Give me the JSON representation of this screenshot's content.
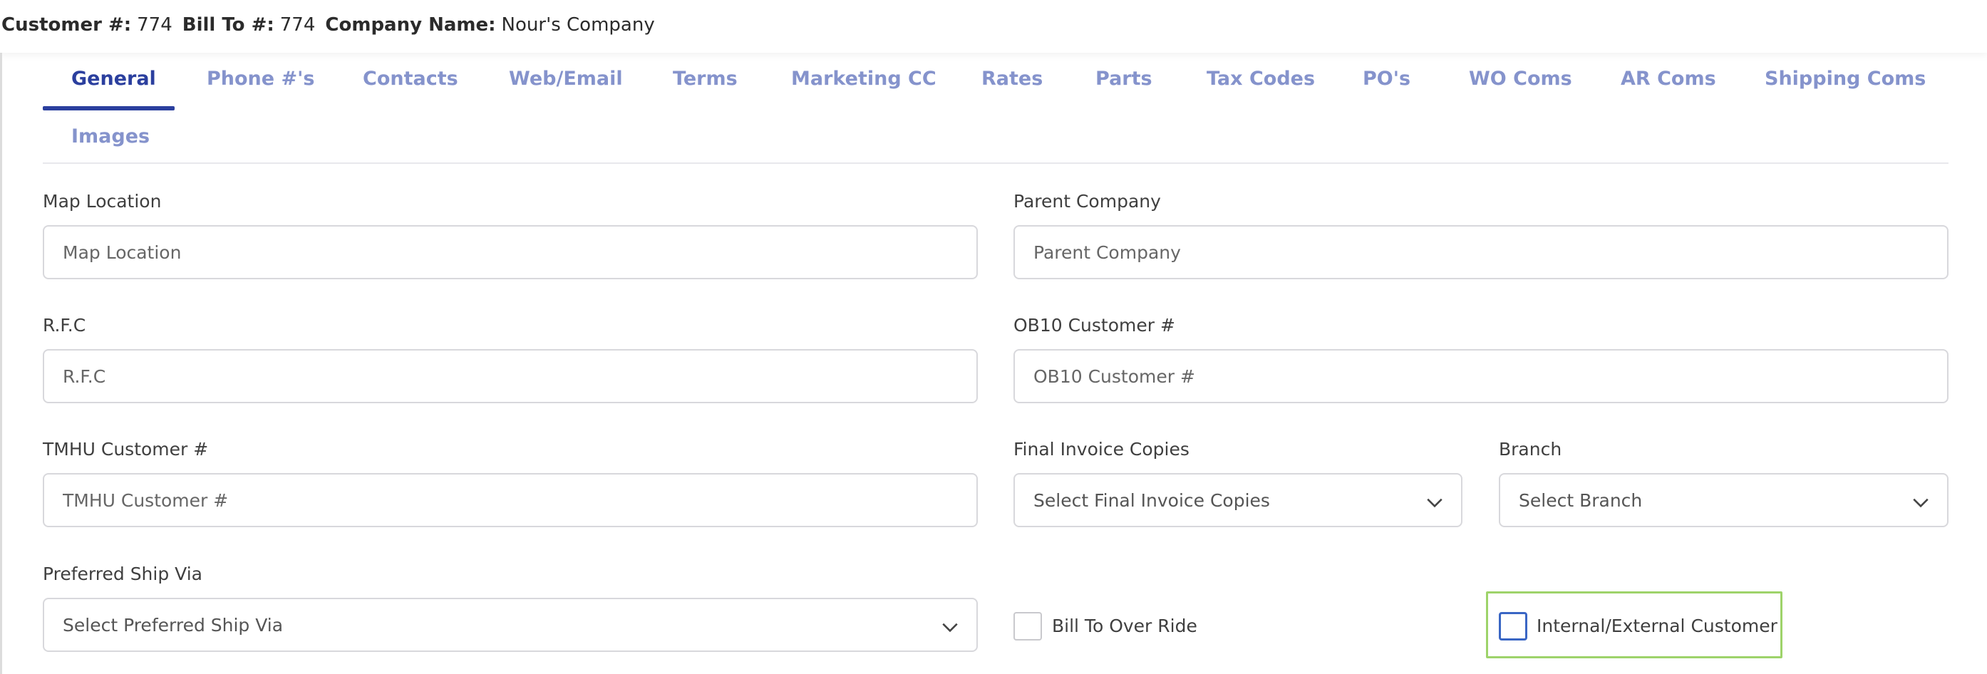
{
  "header": {
    "customer_label": "Customer #:",
    "customer_value": "774",
    "billto_label": "Bill To #:",
    "billto_value": "774",
    "company_label": "Company Name:",
    "company_value": "Nour's Company"
  },
  "tabs": [
    {
      "label": "General",
      "active": true
    },
    {
      "label": "Phone #'s"
    },
    {
      "label": "Contacts"
    },
    {
      "label": "Web/Email"
    },
    {
      "label": "Terms"
    },
    {
      "label": "Marketing CC"
    },
    {
      "label": "Rates"
    },
    {
      "label": "Parts"
    },
    {
      "label": "Tax Codes"
    },
    {
      "label": "PO's"
    },
    {
      "label": "WO Coms"
    },
    {
      "label": "AR Coms"
    },
    {
      "label": "Shipping Coms"
    },
    {
      "label": "Images"
    }
  ],
  "form": {
    "map_location": {
      "label": "Map Location",
      "placeholder": "Map Location",
      "value": ""
    },
    "parent_company": {
      "label": "Parent Company",
      "placeholder": "Parent Company",
      "value": ""
    },
    "rfc": {
      "label": "R.F.C",
      "placeholder": "R.F.C",
      "value": ""
    },
    "ob10": {
      "label": "OB10 Customer #",
      "placeholder": "OB10 Customer #",
      "value": ""
    },
    "tmhu": {
      "label": "TMHU Customer #",
      "placeholder": "TMHU Customer #",
      "value": ""
    },
    "final_invoice_copies": {
      "label": "Final Invoice Copies",
      "selected": "Select Final Invoice Copies"
    },
    "branch": {
      "label": "Branch",
      "selected": "Select Branch"
    },
    "preferred_ship_via": {
      "label": "Preferred Ship Via",
      "selected": "Select Preferred Ship Via"
    },
    "bill_to_over_ride": {
      "label": "Bill To Over Ride",
      "checked": false
    },
    "internal_external": {
      "label": "Internal/External Customer",
      "checked": false
    }
  },
  "colors": {
    "tab_active": "#2b3f9e",
    "tab_inactive": "#8593cc",
    "focus_frame": "#9ed36a",
    "checkbox_focus": "#3a66c4"
  },
  "icons": {
    "select_arrow": "chevron-down-icon"
  }
}
